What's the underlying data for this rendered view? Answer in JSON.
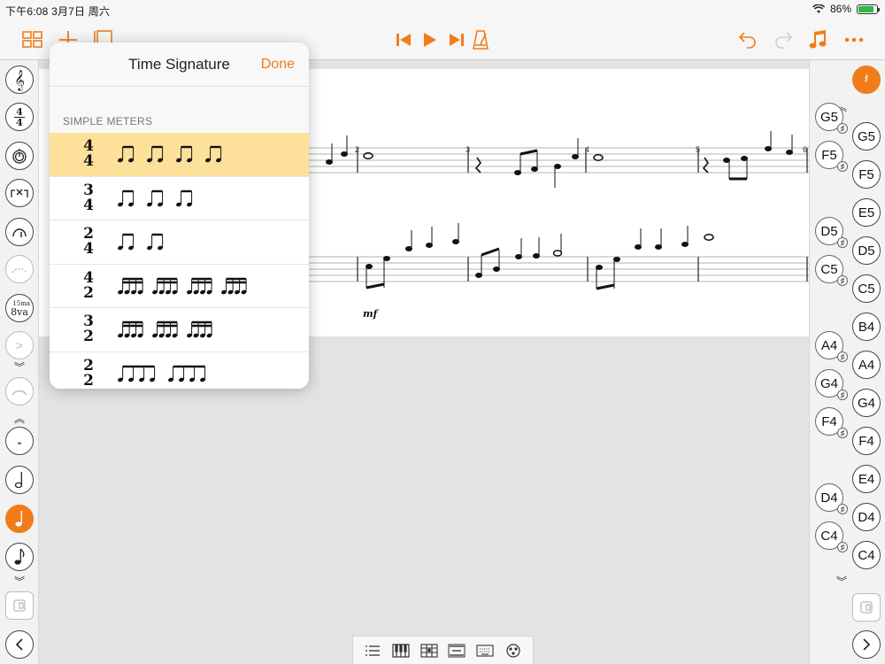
{
  "status": {
    "time_date": "下午6:08   3月7日 周六",
    "battery": "86%",
    "battery_level": 0.86
  },
  "colors": {
    "accent": "#f07d1a",
    "selected_row": "#fde09a"
  },
  "popover": {
    "title": "Time Signature",
    "done": "Done",
    "section": "SIMPLE METERS",
    "meters": [
      {
        "num": "4",
        "den": "4",
        "groups": [
          2,
          2,
          2,
          2
        ],
        "kind": "eighth",
        "selected": true
      },
      {
        "num": "3",
        "den": "4",
        "groups": [
          2,
          2,
          2
        ],
        "kind": "eighth",
        "selected": false
      },
      {
        "num": "2",
        "den": "4",
        "groups": [
          2,
          2
        ],
        "kind": "eighth",
        "selected": false
      },
      {
        "num": "4",
        "den": "2",
        "groups": [
          4,
          4,
          4,
          4
        ],
        "kind": "sixteenth",
        "selected": false
      },
      {
        "num": "3",
        "den": "2",
        "groups": [
          4,
          4,
          4
        ],
        "kind": "sixteenth",
        "selected": false
      },
      {
        "num": "2",
        "den": "2",
        "groups": [
          4,
          4
        ],
        "kind": "eighth",
        "selected": false
      }
    ]
  },
  "score": {
    "measures_top": [
      "2",
      "3",
      "4",
      "5",
      "6"
    ],
    "dynamic": "mf"
  },
  "left_rail": {
    "time_sig_num": "4",
    "time_sig_den": "4",
    "ottava": "8va",
    "ottava_small": "15ma"
  },
  "right_rail": {
    "pitches": [
      "G5",
      "F5",
      "E5",
      "D5",
      "C5",
      "B4",
      "A4",
      "G4",
      "F4",
      "E4",
      "D4",
      "C4"
    ],
    "sharps": [
      "G5",
      "F5",
      "D5",
      "C5",
      "A4",
      "G4",
      "F4",
      "D4",
      "C4"
    ]
  },
  "icons": {
    "toolbar": [
      "grid-icon",
      "plus-icon",
      "page-icon",
      "skip-back-icon",
      "play-icon",
      "skip-forward-icon",
      "metronome-icon",
      "undo-icon",
      "redo-icon",
      "music-note-icon",
      "more-icon"
    ],
    "bottom_tabs": [
      "list-icon",
      "piano-icon",
      "guitar-icon",
      "mixer-icon",
      "keyboard-icon",
      "drum-icon"
    ]
  }
}
